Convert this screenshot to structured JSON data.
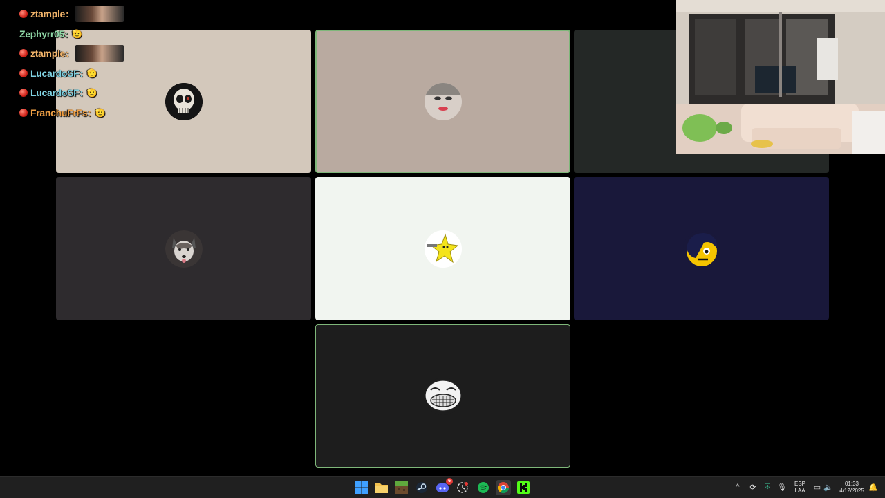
{
  "chat": {
    "messages": [
      {
        "user": "ztample",
        "color": "#f2b46a",
        "badge": true,
        "emote_type": "image"
      },
      {
        "user": "Zephyrr05",
        "color": "#8fd7a6",
        "badge": false,
        "emote_type": "emoji",
        "emote": "🫡"
      },
      {
        "user": "ztample",
        "color": "#f2b46a",
        "badge": true,
        "emote_type": "image"
      },
      {
        "user": "LucardoSF",
        "color": "#7fd0e0",
        "badge": true,
        "emote_type": "emoji",
        "emote": "🫡"
      },
      {
        "user": "LucardoSF",
        "color": "#7fd0e0",
        "badge": true,
        "emote_type": "emoji",
        "emote": "🫡"
      },
      {
        "user": "FranchuFrFs",
        "color": "#f0a045",
        "badge": true,
        "emote_type": "emoji",
        "emote": "🫡"
      }
    ],
    "separator": ":"
  },
  "tiles": [
    {
      "avatar": "skull-avatar",
      "bg": "#d3c8bb",
      "state": "normal"
    },
    {
      "avatar": "face-avatar",
      "bg": "#b9aaa0",
      "state": "speaking"
    },
    {
      "avatar": "",
      "bg": "#242826",
      "state": "normal"
    },
    {
      "avatar": "husky-avatar",
      "bg": "#2e2b2e",
      "state": "normal"
    },
    {
      "avatar": "star-avatar",
      "bg": "#f1f5f0",
      "state": "normal"
    },
    {
      "avatar": "emo-smiley-avatar",
      "bg": "#19183a",
      "state": "normal"
    },
    {
      "avatar": "trollface-avatar",
      "bg": "#1d1d1d",
      "state": "active"
    }
  ],
  "taskbar": {
    "apps": [
      "windows-start-icon",
      "file-explorer-icon",
      "minecraft-icon",
      "steam-icon",
      "discord-icon",
      "clock-app-icon",
      "spotify-icon",
      "chrome-icon",
      "kick-icon"
    ],
    "discord_badge": "6",
    "language": {
      "line1": "ESP",
      "line2": "LAA"
    },
    "time": "01:33",
    "date": "4/12/2025"
  }
}
